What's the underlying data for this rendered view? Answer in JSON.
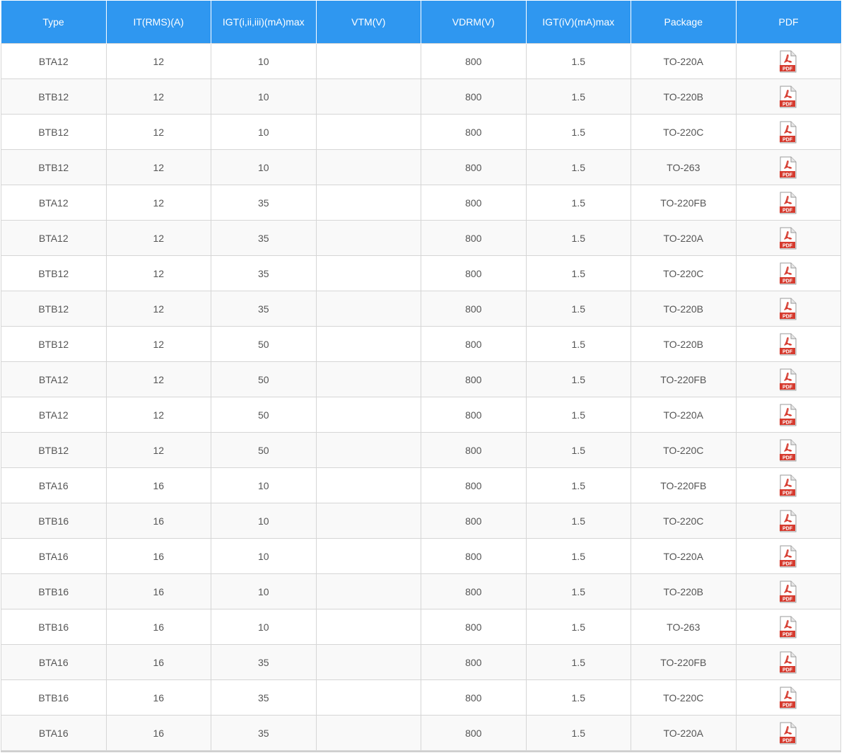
{
  "table": {
    "headers": [
      "Type",
      "IT(RMS)(A)",
      "IGT(i,ii,iii)(mA)max",
      "VTM(V)",
      "VDRM(V)",
      "IGT(iV)(mA)max",
      "Package",
      "PDF"
    ],
    "rows": [
      {
        "type": "BTA12",
        "it_rms": "12",
        "igt": "10",
        "vtm": "",
        "vdrm": "800",
        "igt_iv": "1.5",
        "package": "TO-220A"
      },
      {
        "type": "BTB12",
        "it_rms": "12",
        "igt": "10",
        "vtm": "",
        "vdrm": "800",
        "igt_iv": "1.5",
        "package": "TO-220B"
      },
      {
        "type": "BTB12",
        "it_rms": "12",
        "igt": "10",
        "vtm": "",
        "vdrm": "800",
        "igt_iv": "1.5",
        "package": "TO-220C"
      },
      {
        "type": "BTB12",
        "it_rms": "12",
        "igt": "10",
        "vtm": "",
        "vdrm": "800",
        "igt_iv": "1.5",
        "package": "TO-263"
      },
      {
        "type": "BTA12",
        "it_rms": "12",
        "igt": "35",
        "vtm": "",
        "vdrm": "800",
        "igt_iv": "1.5",
        "package": "TO-220FB"
      },
      {
        "type": "BTA12",
        "it_rms": "12",
        "igt": "35",
        "vtm": "",
        "vdrm": "800",
        "igt_iv": "1.5",
        "package": "TO-220A"
      },
      {
        "type": "BTB12",
        "it_rms": "12",
        "igt": "35",
        "vtm": "",
        "vdrm": "800",
        "igt_iv": "1.5",
        "package": "TO-220C"
      },
      {
        "type": "BTB12",
        "it_rms": "12",
        "igt": "35",
        "vtm": "",
        "vdrm": "800",
        "igt_iv": "1.5",
        "package": "TO-220B"
      },
      {
        "type": "BTB12",
        "it_rms": "12",
        "igt": "50",
        "vtm": "",
        "vdrm": "800",
        "igt_iv": "1.5",
        "package": "TO-220B"
      },
      {
        "type": "BTA12",
        "it_rms": "12",
        "igt": "50",
        "vtm": "",
        "vdrm": "800",
        "igt_iv": "1.5",
        "package": "TO-220FB"
      },
      {
        "type": "BTA12",
        "it_rms": "12",
        "igt": "50",
        "vtm": "",
        "vdrm": "800",
        "igt_iv": "1.5",
        "package": "TO-220A"
      },
      {
        "type": "BTB12",
        "it_rms": "12",
        "igt": "50",
        "vtm": "",
        "vdrm": "800",
        "igt_iv": "1.5",
        "package": "TO-220C"
      },
      {
        "type": "BTA16",
        "it_rms": "16",
        "igt": "10",
        "vtm": "",
        "vdrm": "800",
        "igt_iv": "1.5",
        "package": "TO-220FB"
      },
      {
        "type": "BTB16",
        "it_rms": "16",
        "igt": "10",
        "vtm": "",
        "vdrm": "800",
        "igt_iv": "1.5",
        "package": "TO-220C"
      },
      {
        "type": "BTA16",
        "it_rms": "16",
        "igt": "10",
        "vtm": "",
        "vdrm": "800",
        "igt_iv": "1.5",
        "package": "TO-220A"
      },
      {
        "type": "BTB16",
        "it_rms": "16",
        "igt": "10",
        "vtm": "",
        "vdrm": "800",
        "igt_iv": "1.5",
        "package": "TO-220B"
      },
      {
        "type": "BTB16",
        "it_rms": "16",
        "igt": "10",
        "vtm": "",
        "vdrm": "800",
        "igt_iv": "1.5",
        "package": "TO-263"
      },
      {
        "type": "BTA16",
        "it_rms": "16",
        "igt": "35",
        "vtm": "",
        "vdrm": "800",
        "igt_iv": "1.5",
        "package": "TO-220FB"
      },
      {
        "type": "BTB16",
        "it_rms": "16",
        "igt": "35",
        "vtm": "",
        "vdrm": "800",
        "igt_iv": "1.5",
        "package": "TO-220C"
      },
      {
        "type": "BTA16",
        "it_rms": "16",
        "igt": "35",
        "vtm": "",
        "vdrm": "800",
        "igt_iv": "1.5",
        "package": "TO-220A"
      }
    ],
    "pdf_icon": {
      "name": "pdf-icon",
      "label": "PDF",
      "color": "#d63b2f"
    }
  },
  "colors": {
    "header_bg": "#2f97f0",
    "header_text": "#ffffff",
    "cell_text": "#555555",
    "border": "#d6d6d6",
    "stripe": "#f9f9f9"
  }
}
